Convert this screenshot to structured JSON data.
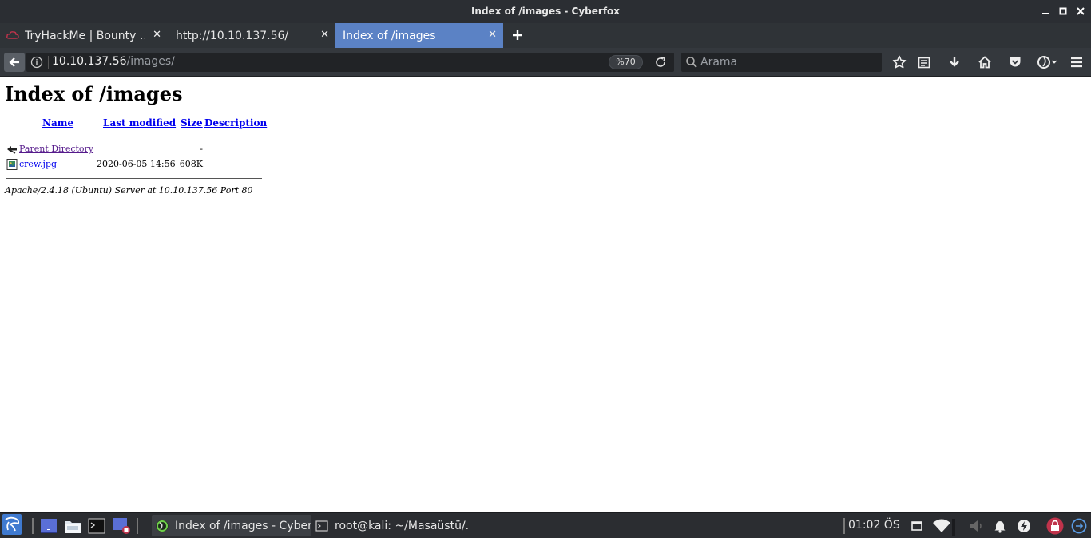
{
  "window": {
    "title": "Index of /images - Cyberfox",
    "minimize_glyph": "▁",
    "maximize_glyph": "▢",
    "close_glyph": "✕"
  },
  "tabs": [
    {
      "label": "TryHackMe | Bounty ...",
      "close": "✕",
      "active": false,
      "icon": "cloud-icon"
    },
    {
      "label": "http://10.10.137.56/",
      "close": "✕",
      "active": false
    },
    {
      "label": "Index of /images",
      "close": "✕",
      "active": true
    }
  ],
  "new_tab_glyph": "+",
  "navbar": {
    "url_host": "10.10.137.56",
    "url_path": "/images/",
    "zoom": "%70",
    "search_placeholder": "Arama"
  },
  "page": {
    "heading": "Index of /images",
    "columns": {
      "name": "Name",
      "last_modified": "Last modified",
      "size": "Size",
      "description": "Description"
    },
    "rows": [
      {
        "name": "Parent Directory",
        "date": "",
        "size": "-",
        "icon": "back-arrow-icon"
      },
      {
        "name": "crew.jpg",
        "date": "2020-06-05 14:56",
        "size": "608K",
        "icon": "image-file-icon"
      }
    ],
    "address": "Apache/2.4.18 (Ubuntu) Server at 10.10.137.56 Port 80"
  },
  "taskbar": {
    "tasks": [
      {
        "label": "Index of /images - Cyber...",
        "icon": "cyberfox-icon",
        "active": true
      },
      {
        "label": "root@kali: ~/Masaüstü/...",
        "icon": "terminal-icon",
        "active": false
      }
    ],
    "clock": "01:02 ÖS",
    "colors": {
      "accent": "#5b82c5",
      "lock": "#c0334b"
    }
  }
}
